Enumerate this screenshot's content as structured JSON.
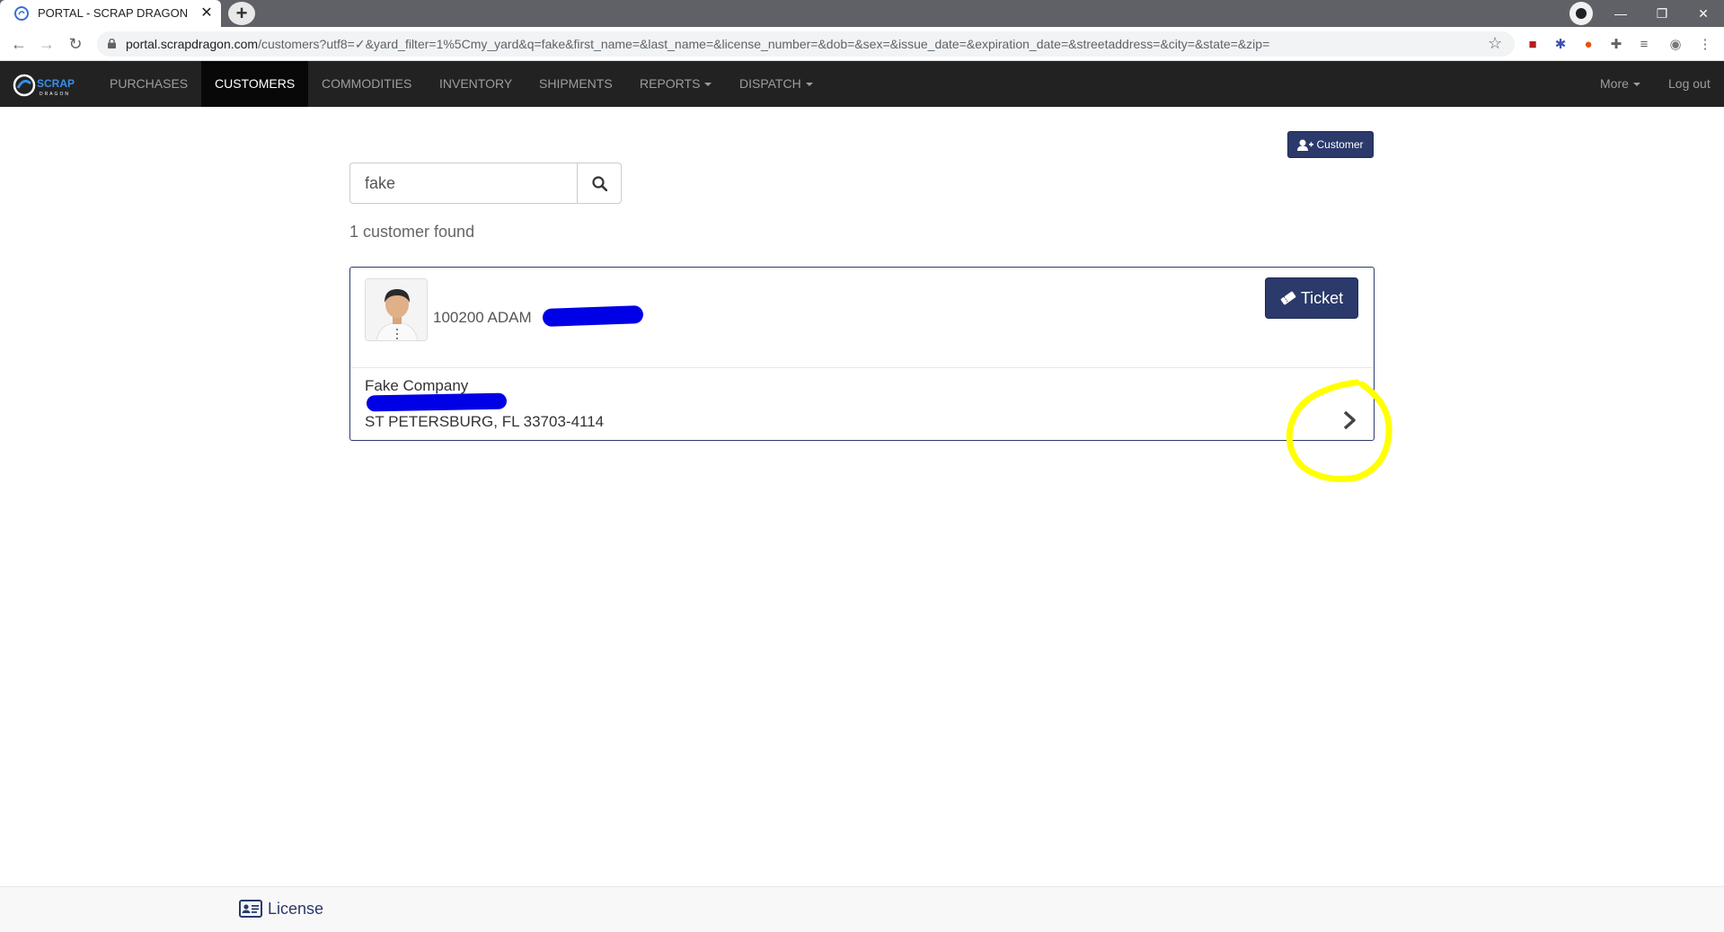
{
  "browser": {
    "tab_title": "PORTAL - SCRAP DRAGON",
    "tab_close": "✕",
    "new_tab": "+",
    "url_host": "portal.scrapdragon.com",
    "url_path": "/customers?utf8=✓&yard_filter=1%5Cmy_yard&q=fake&first_name=&last_name=&license_number=&dob=&sex=&issue_date=&expiration_date=&streetaddress=&city=&state=&zip="
  },
  "navbar": {
    "brand": "SCRAP",
    "brand_sub": "DRAGON",
    "items": [
      {
        "label": "PURCHASES"
      },
      {
        "label": "CUSTOMERS"
      },
      {
        "label": "COMMODITIES"
      },
      {
        "label": "INVENTORY"
      },
      {
        "label": "SHIPMENTS"
      },
      {
        "label": "REPORTS"
      },
      {
        "label": "DISPATCH"
      }
    ],
    "more": "More",
    "logout": "Log out"
  },
  "content": {
    "add_customer_label": "Customer",
    "search_value": "fake",
    "result_count": "1 customer found",
    "customer": {
      "name": "100200 ADAM",
      "company": "Fake Company",
      "city_line": "ST PETERSBURG, FL 33703-4114",
      "ticket_label": "Ticket"
    }
  },
  "footer": {
    "license_label": "License"
  },
  "colors": {
    "accent": "#2b3a6b",
    "navbar_bg": "#222222",
    "redaction": "#0000e6",
    "highlight": "#ffff00"
  }
}
